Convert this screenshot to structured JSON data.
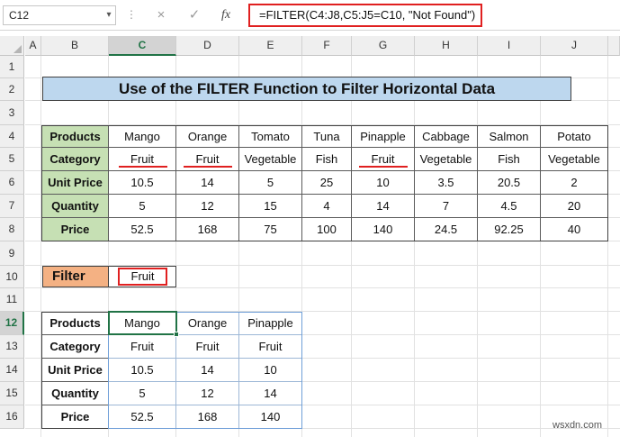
{
  "formula_bar": {
    "name_box": "C12",
    "cancel_icon": "×",
    "enter_icon": "✓",
    "fx_label": "fx",
    "formula": "=FILTER(C4:J8,C5:J5=C10, \"Not Found\")"
  },
  "columns": [
    "A",
    "B",
    "C",
    "D",
    "E",
    "F",
    "G",
    "H",
    "I",
    "J"
  ],
  "rows": [
    "1",
    "2",
    "3",
    "4",
    "5",
    "6",
    "7",
    "8",
    "9",
    "10",
    "11",
    "12",
    "13",
    "14",
    "15",
    "16"
  ],
  "title": "Use of the FILTER Function to Filter Horizontal Data",
  "source_table": {
    "rows": [
      {
        "label": "Products",
        "values": [
          "Mango",
          "Orange",
          "Tomato",
          "Tuna",
          "Pinapple",
          "Cabbage",
          "Salmon",
          "Potato"
        ]
      },
      {
        "label": "Category",
        "values": [
          "Fruit",
          "Fruit",
          "Vegetable",
          "Fish",
          "Fruit",
          "Vegetable",
          "Fish",
          "Vegetable"
        ]
      },
      {
        "label": "Unit Price",
        "values": [
          "10.5",
          "14",
          "5",
          "25",
          "10",
          "3.5",
          "20.5",
          "2"
        ]
      },
      {
        "label": "Quantity",
        "values": [
          "5",
          "12",
          "15",
          "4",
          "14",
          "7",
          "4.5",
          "20"
        ]
      },
      {
        "label": "Price",
        "values": [
          "52.5",
          "168",
          "75",
          "100",
          "140",
          "24.5",
          "92.25",
          "40"
        ]
      }
    ]
  },
  "filter": {
    "label": "Filter",
    "value": "Fruit"
  },
  "result_table": {
    "rows": [
      {
        "label": "Products",
        "values": [
          "Mango",
          "Orange",
          "Pinapple"
        ]
      },
      {
        "label": "Category",
        "values": [
          "Fruit",
          "Fruit",
          "Fruit"
        ]
      },
      {
        "label": "Unit Price",
        "values": [
          "10.5",
          "14",
          "10"
        ]
      },
      {
        "label": "Quantity",
        "values": [
          "5",
          "12",
          "14"
        ]
      },
      {
        "label": "Price",
        "values": [
          "52.5",
          "168",
          "140"
        ]
      }
    ]
  },
  "watermark": "wsxdn.com",
  "colors": {
    "accent": "#217346",
    "highlight": "#e02020",
    "title_fill": "#bdd7ee",
    "header_fill": "#c6e0b4",
    "filter_fill": "#f4b183"
  }
}
